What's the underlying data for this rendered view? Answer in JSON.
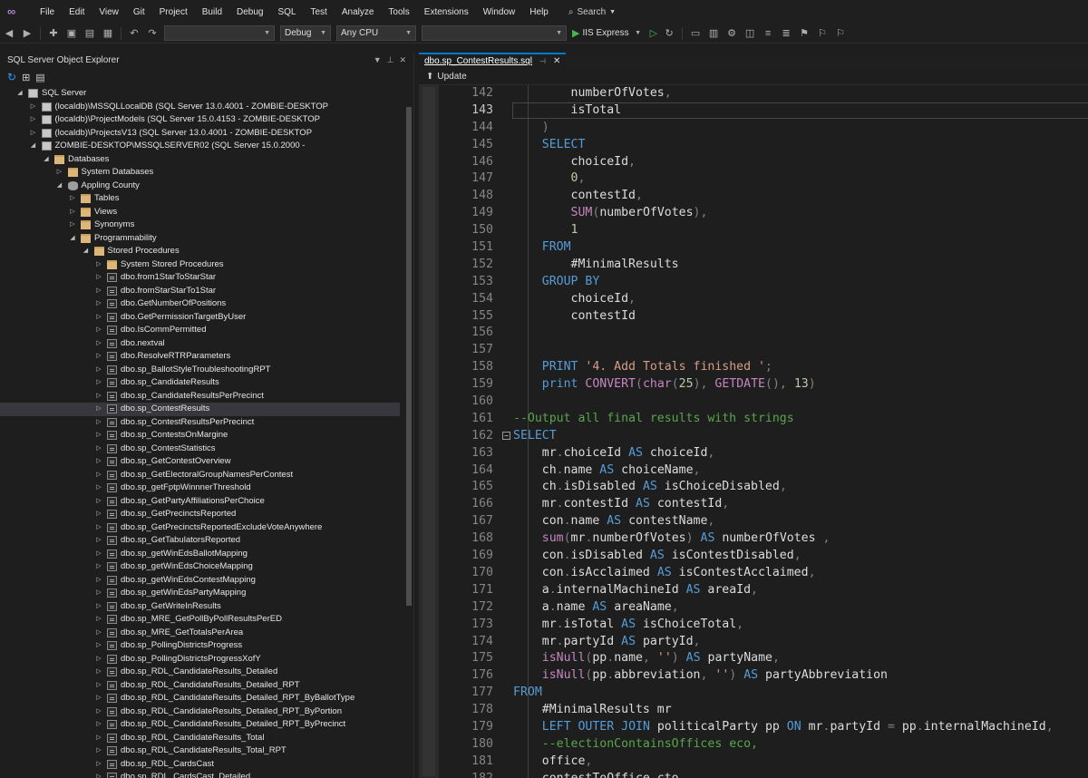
{
  "menu": [
    "File",
    "Edit",
    "View",
    "Git",
    "Project",
    "Build",
    "Debug",
    "SQL",
    "Test",
    "Analyze",
    "Tools",
    "Extensions",
    "Window",
    "Help"
  ],
  "search_label": "Search",
  "toolbar": {
    "config": "Debug",
    "platform": "Any CPU",
    "run_target": "IIS Express"
  },
  "explorer": {
    "title": "SQL Server Object Explorer",
    "rows": [
      {
        "label": "SQL Server",
        "depth": 0,
        "icon": "server",
        "tw": "open"
      },
      {
        "label": "(localdb)\\MSSQLLocalDB (SQL Server 13.0.4001 - ZOMBIE-DESKTOP",
        "depth": 1,
        "icon": "server",
        "tw": "closed"
      },
      {
        "label": "(localdb)\\ProjectModels (SQL Server 15.0.4153 - ZOMBIE-DESKTOP",
        "depth": 1,
        "icon": "server",
        "tw": "closed"
      },
      {
        "label": "(localdb)\\ProjectsV13 (SQL Server 13.0.4001 - ZOMBIE-DESKTOP",
        "depth": 1,
        "icon": "server",
        "tw": "closed"
      },
      {
        "label": "ZOMBIE-DESKTOP\\MSSQLSERVER02 (SQL Server 15.0.2000 -",
        "depth": 1,
        "icon": "server",
        "tw": "open"
      },
      {
        "label": "Databases",
        "depth": 2,
        "icon": "folder",
        "tw": "open"
      },
      {
        "label": "System Databases",
        "depth": 3,
        "icon": "folder",
        "tw": "closed"
      },
      {
        "label": "Appling County",
        "depth": 3,
        "icon": "db",
        "tw": "open"
      },
      {
        "label": "Tables",
        "depth": 4,
        "icon": "folder",
        "tw": "closed"
      },
      {
        "label": "Views",
        "depth": 4,
        "icon": "folder",
        "tw": "closed"
      },
      {
        "label": "Synonyms",
        "depth": 4,
        "icon": "folder",
        "tw": "closed"
      },
      {
        "label": "Programmability",
        "depth": 4,
        "icon": "folder",
        "tw": "open"
      },
      {
        "label": "Stored Procedures",
        "depth": 5,
        "icon": "folder",
        "tw": "open"
      },
      {
        "label": "System Stored Procedures",
        "depth": 6,
        "icon": "folder",
        "tw": "closed"
      },
      {
        "label": "dbo.from1StarToStarStar",
        "depth": 6,
        "icon": "sp",
        "tw": "closed"
      },
      {
        "label": "dbo.fromStarStarTo1Star",
        "depth": 6,
        "icon": "sp",
        "tw": "closed"
      },
      {
        "label": "dbo.GetNumberOfPositions",
        "depth": 6,
        "icon": "sp",
        "tw": "closed"
      },
      {
        "label": "dbo.GetPermissionTargetByUser",
        "depth": 6,
        "icon": "sp",
        "tw": "closed"
      },
      {
        "label": "dbo.IsCommPermitted",
        "depth": 6,
        "icon": "sp",
        "tw": "closed"
      },
      {
        "label": "dbo.nextval",
        "depth": 6,
        "icon": "sp",
        "tw": "closed"
      },
      {
        "label": "dbo.ResolveRTRParameters",
        "depth": 6,
        "icon": "sp",
        "tw": "closed"
      },
      {
        "label": "dbo.sp_BallotStyleTroubleshootingRPT",
        "depth": 6,
        "icon": "sp",
        "tw": "closed"
      },
      {
        "label": "dbo.sp_CandidateResults",
        "depth": 6,
        "icon": "sp",
        "tw": "closed"
      },
      {
        "label": "dbo.sp_CandidateResultsPerPrecinct",
        "depth": 6,
        "icon": "sp",
        "tw": "closed"
      },
      {
        "label": "dbo.sp_ContestResults",
        "depth": 6,
        "icon": "sp",
        "tw": "closed",
        "selected": true
      },
      {
        "label": "dbo.sp_ContestResultsPerPrecinct",
        "depth": 6,
        "icon": "sp",
        "tw": "closed"
      },
      {
        "label": "dbo.sp_ContestsOnMargine",
        "depth": 6,
        "icon": "sp",
        "tw": "closed"
      },
      {
        "label": "dbo.sp_ContestStatistics",
        "depth": 6,
        "icon": "sp",
        "tw": "closed"
      },
      {
        "label": "dbo.sp_GetContestOverview",
        "depth": 6,
        "icon": "sp",
        "tw": "closed"
      },
      {
        "label": "dbo.sp_GetElectoralGroupNamesPerContest",
        "depth": 6,
        "icon": "sp",
        "tw": "closed"
      },
      {
        "label": "dbo.sp_getFptpWinnnerThreshold",
        "depth": 6,
        "icon": "sp",
        "tw": "closed"
      },
      {
        "label": "dbo.sp_GetPartyAffiliationsPerChoice",
        "depth": 6,
        "icon": "sp",
        "tw": "closed"
      },
      {
        "label": "dbo.sp_GetPrecinctsReported",
        "depth": 6,
        "icon": "sp",
        "tw": "closed"
      },
      {
        "label": "dbo.sp_GetPrecinctsReportedExcludeVoteAnywhere",
        "depth": 6,
        "icon": "sp",
        "tw": "closed"
      },
      {
        "label": "dbo.sp_GetTabulatorsReported",
        "depth": 6,
        "icon": "sp",
        "tw": "closed"
      },
      {
        "label": "dbo.sp_getWinEdsBallotMapping",
        "depth": 6,
        "icon": "sp",
        "tw": "closed"
      },
      {
        "label": "dbo.sp_getWinEdsChoiceMapping",
        "depth": 6,
        "icon": "sp",
        "tw": "closed"
      },
      {
        "label": "dbo.sp_getWinEdsContestMapping",
        "depth": 6,
        "icon": "sp",
        "tw": "closed"
      },
      {
        "label": "dbo.sp_getWinEdsPartyMapping",
        "depth": 6,
        "icon": "sp",
        "tw": "closed"
      },
      {
        "label": "dbo.sp_GetWriteInResults",
        "depth": 6,
        "icon": "sp",
        "tw": "closed"
      },
      {
        "label": "dbo.sp_MRE_GetPollByPollResultsPerED",
        "depth": 6,
        "icon": "sp",
        "tw": "closed"
      },
      {
        "label": "dbo.sp_MRE_GetTotalsPerArea",
        "depth": 6,
        "icon": "sp",
        "tw": "closed"
      },
      {
        "label": "dbo.sp_PollingDistrictsProgress",
        "depth": 6,
        "icon": "sp",
        "tw": "closed"
      },
      {
        "label": "dbo.sp_PollingDistrictsProgressXofY",
        "depth": 6,
        "icon": "sp",
        "tw": "closed"
      },
      {
        "label": "dbo.sp_RDL_CandidateResults_Detailed",
        "depth": 6,
        "icon": "sp",
        "tw": "closed"
      },
      {
        "label": "dbo.sp_RDL_CandidateResults_Detailed_RPT",
        "depth": 6,
        "icon": "sp",
        "tw": "closed"
      },
      {
        "label": "dbo.sp_RDL_CandidateResults_Detailed_RPT_ByBallotType",
        "depth": 6,
        "icon": "sp",
        "tw": "closed"
      },
      {
        "label": "dbo.sp_RDL_CandidateResults_Detailed_RPT_ByPortion",
        "depth": 6,
        "icon": "sp",
        "tw": "closed"
      },
      {
        "label": "dbo.sp_RDL_CandidateResults_Detailed_RPT_ByPrecinct",
        "depth": 6,
        "icon": "sp",
        "tw": "closed"
      },
      {
        "label": "dbo.sp_RDL_CandidateResults_Total",
        "depth": 6,
        "icon": "sp",
        "tw": "closed"
      },
      {
        "label": "dbo.sp_RDL_CandidateResults_Total_RPT",
        "depth": 6,
        "icon": "sp",
        "tw": "closed"
      },
      {
        "label": "dbo.sp_RDL_CardsCast",
        "depth": 6,
        "icon": "sp",
        "tw": "closed"
      },
      {
        "label": "dbo.sp_RDL_CardsCast_Detailed",
        "depth": 6,
        "icon": "sp",
        "tw": "closed"
      }
    ]
  },
  "editor": {
    "tab_label": "dbo.sp_ContestResults.sql",
    "update_label": "Update",
    "current_line": 143,
    "lines": [
      {
        "n": 142,
        "code": "        numberOfVotes,"
      },
      {
        "n": 143,
        "code": "        isTotal"
      },
      {
        "n": 144,
        "code": "    )"
      },
      {
        "n": 145,
        "code": "    SELECT"
      },
      {
        "n": 146,
        "code": "        choiceId,"
      },
      {
        "n": 147,
        "code": "        0,"
      },
      {
        "n": 148,
        "code": "        contestId,"
      },
      {
        "n": 149,
        "code": "        SUM(numberOfVotes),"
      },
      {
        "n": 150,
        "code": "        1"
      },
      {
        "n": 151,
        "code": "    FROM"
      },
      {
        "n": 152,
        "code": "        #MinimalResults"
      },
      {
        "n": 153,
        "code": "    GROUP BY"
      },
      {
        "n": 154,
        "code": "        choiceId,"
      },
      {
        "n": 155,
        "code": "        contestId"
      },
      {
        "n": 156,
        "code": ""
      },
      {
        "n": 157,
        "code": ""
      },
      {
        "n": 158,
        "code": "    PRINT '4. Add Totals finished ';"
      },
      {
        "n": 159,
        "code": "    print CONVERT(char(25), GETDATE(), 13)"
      },
      {
        "n": 160,
        "code": ""
      },
      {
        "n": 161,
        "code": "--Output all final results with strings"
      },
      {
        "n": 162,
        "code": "SELECT",
        "fold": true
      },
      {
        "n": 163,
        "code": "    mr.choiceId AS choiceId,"
      },
      {
        "n": 164,
        "code": "    ch.name AS choiceName,"
      },
      {
        "n": 165,
        "code": "    ch.isDisabled AS isChoiceDisabled,"
      },
      {
        "n": 166,
        "code": "    mr.contestId AS contestId,"
      },
      {
        "n": 167,
        "code": "    con.name AS contestName,"
      },
      {
        "n": 168,
        "code": "    sum(mr.numberOfVotes) AS numberOfVotes ,"
      },
      {
        "n": 169,
        "code": "    con.isDisabled AS isContestDisabled,"
      },
      {
        "n": 170,
        "code": "    con.isAcclaimed AS isContestAcclaimed,"
      },
      {
        "n": 171,
        "code": "    a.internalMachineId AS areaId,"
      },
      {
        "n": 172,
        "code": "    a.name AS areaName,"
      },
      {
        "n": 173,
        "code": "    mr.isTotal AS isChoiceTotal,"
      },
      {
        "n": 174,
        "code": "    mr.partyId AS partyId,"
      },
      {
        "n": 175,
        "code": "    isNull(pp.name, '') AS partyName,"
      },
      {
        "n": 176,
        "code": "    isNull(pp.abbreviation, '') AS partyAbbreviation"
      },
      {
        "n": 177,
        "code": "FROM"
      },
      {
        "n": 178,
        "code": "    #MinimalResults mr"
      },
      {
        "n": 179,
        "code": "    LEFT OUTER JOIN politicalParty pp ON mr.partyId = pp.internalMachineId,"
      },
      {
        "n": 180,
        "code": "    --electionContainsOffices eco,"
      },
      {
        "n": 181,
        "code": "    office,"
      },
      {
        "n": 182,
        "code": "    contestToOffice cto"
      }
    ]
  }
}
